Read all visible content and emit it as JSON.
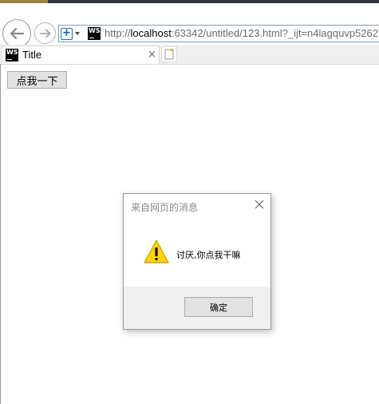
{
  "browser": {
    "url_prefix": "http://",
    "url_host": "localhost",
    "url_rest": ":63342/untitled/123.html?_ijt=n4lagquvp5262",
    "tab_title": "Title",
    "tab_close": "×",
    "site_icon_text": "WS"
  },
  "page": {
    "button_label": "点我一下"
  },
  "dialog": {
    "title": "来自网页的消息",
    "message": "讨厌,你点我干嘛",
    "ok_label": "确定"
  },
  "colors": {
    "warning_yellow": "#ffd400",
    "address_border": "#7f9db9",
    "button_face": "#e1e1e1"
  }
}
